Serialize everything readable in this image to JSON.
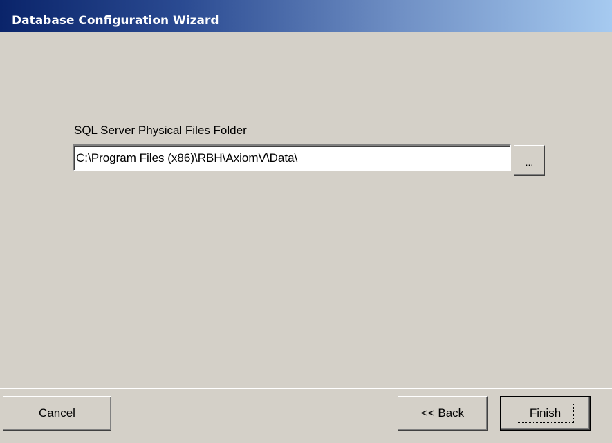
{
  "window": {
    "title": "Database Configuration Wizard"
  },
  "form": {
    "folder_label": "SQL Server Physical Files Folder",
    "folder_value": "C:\\Program Files (x86)\\RBH\\AxiomV\\Data\\",
    "browse_label": "..."
  },
  "buttons": {
    "cancel_label": "Cancel",
    "back_label": "<< Back",
    "finish_label": "Finish"
  },
  "colors": {
    "title_gradient_start": "#0a246a",
    "title_gradient_end": "#a6caf0",
    "window_background": "#d4d0c8"
  }
}
